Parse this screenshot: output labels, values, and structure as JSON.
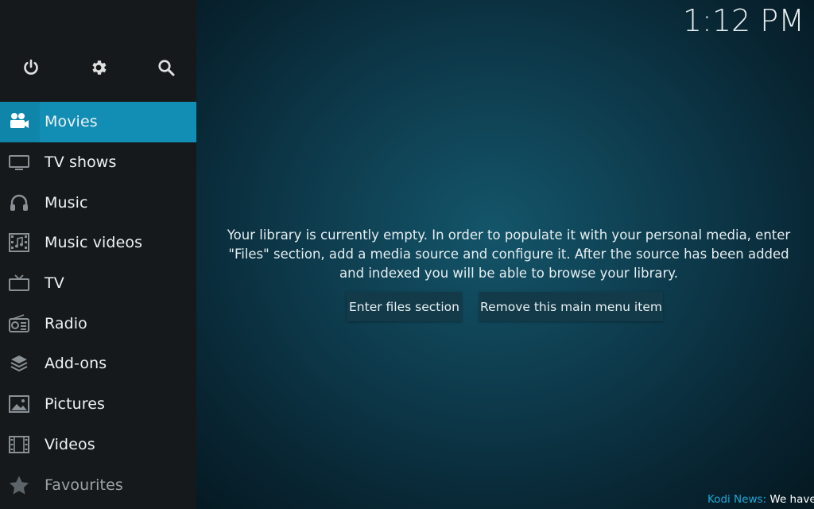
{
  "header": {
    "clock": "1:12 PM"
  },
  "top_icons": [
    {
      "name": "power-icon"
    },
    {
      "name": "gear-icon"
    },
    {
      "name": "search-icon"
    }
  ],
  "sidebar": {
    "items": [
      {
        "label": "Movies",
        "icon": "movie-camera-icon",
        "active": true
      },
      {
        "label": "TV shows",
        "icon": "monitor-icon"
      },
      {
        "label": "Music",
        "icon": "headphones-icon"
      },
      {
        "label": "Music videos",
        "icon": "music-video-icon"
      },
      {
        "label": "TV",
        "icon": "tv-icon"
      },
      {
        "label": "Radio",
        "icon": "radio-icon"
      },
      {
        "label": "Add-ons",
        "icon": "addons-box-icon"
      },
      {
        "label": "Pictures",
        "icon": "picture-icon"
      },
      {
        "label": "Videos",
        "icon": "film-strip-icon"
      },
      {
        "label": "Favourites",
        "icon": "star-icon"
      }
    ]
  },
  "main": {
    "message": "Your library is currently empty. In order to populate it with your personal media, enter \"Files\" section, add a media source and configure it. After the source has been added and indexed you will be able to browse your library.",
    "buttons": {
      "enter_files": "Enter files section",
      "remove_item": "Remove this main menu item"
    }
  },
  "news": {
    "label": "Kodi News:",
    "text": "We have k"
  },
  "colors": {
    "accent": "#128db3",
    "sidebar_bg": "#16191b",
    "news_label": "#1fa9d8"
  }
}
